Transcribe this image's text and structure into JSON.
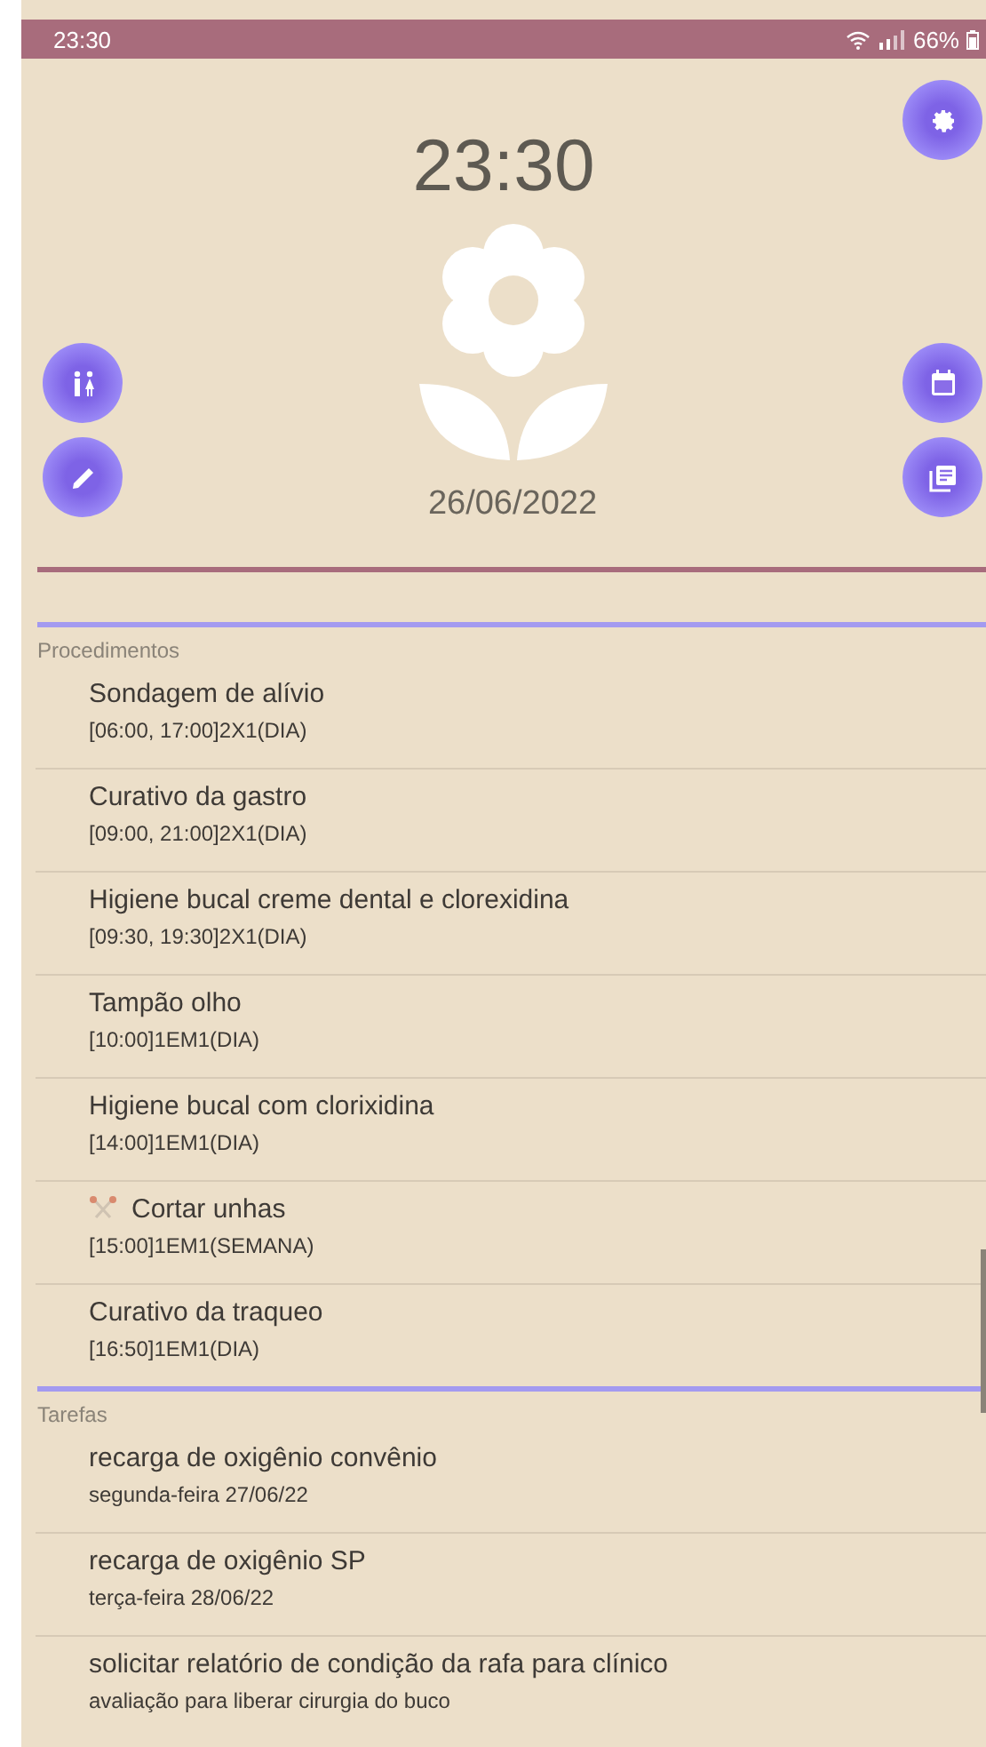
{
  "status_bar": {
    "time": "23:30",
    "battery": "66%"
  },
  "clock": "23:30",
  "date": "26/06/2022",
  "sections": [
    {
      "title": "Procedimentos",
      "items": [
        {
          "title": "Sondagem de alívio",
          "subtitle": "[06:00, 17:00]2X1(DIA)",
          "kind": "plain"
        },
        {
          "title": "Curativo da gastro",
          "subtitle": "[09:00, 21:00]2X1(DIA)",
          "kind": "plain"
        },
        {
          "title": "Higiene bucal creme dental e clorexidina",
          "subtitle": "[09:30, 19:30]2X1(DIA)",
          "kind": "plain"
        },
        {
          "title": "Tampão olho",
          "subtitle": "[10:00]1EM1(DIA)",
          "kind": "plain"
        },
        {
          "title": "Higiene bucal com clorixidina",
          "subtitle": "[14:00]1EM1(DIA)",
          "kind": "plain"
        },
        {
          "title": "Cortar unhas",
          "subtitle": "[15:00]1EM1(SEMANA)",
          "kind": "scissors"
        },
        {
          "title": "Curativo da traqueo",
          "subtitle": "[16:50]1EM1(DIA)",
          "kind": "plain"
        }
      ]
    },
    {
      "title": "Tarefas",
      "items": [
        {
          "title": "recarga de oxigênio convênio",
          "subtitle": "segunda-feira 27/06/22",
          "kind": "plain"
        },
        {
          "title": "recarga de oxigênio SP",
          "subtitle": "terça-feira 28/06/22",
          "kind": "plain"
        },
        {
          "title": "solicitar relatório de condição da rafa para clínico",
          "subtitle": "avaliação para liberar cirurgia do buco",
          "kind": "plain"
        }
      ]
    }
  ]
}
